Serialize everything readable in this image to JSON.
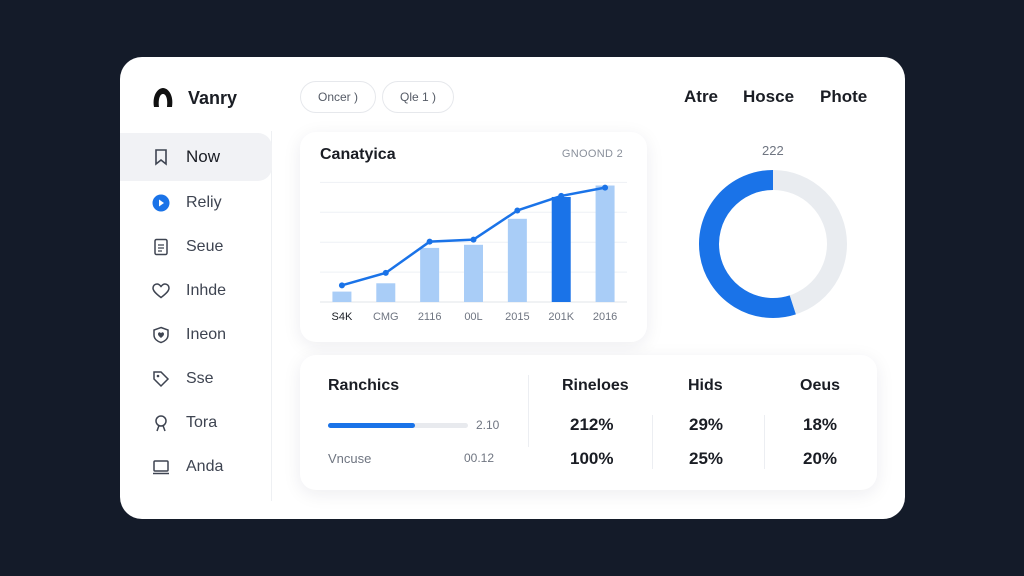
{
  "app": {
    "name": "Vanry"
  },
  "top_pills": [
    "Oncer )",
    "Qle 1 )"
  ],
  "top_nav": [
    "Atre",
    "Hosce",
    "Phote"
  ],
  "sidebar": {
    "items": [
      {
        "label": "Now",
        "icon": "bookmark-icon",
        "active": true
      },
      {
        "label": "Reliy",
        "icon": "play-circle-icon",
        "active": false
      },
      {
        "label": "Seue",
        "icon": "document-icon",
        "active": false
      },
      {
        "label": "Inhde",
        "icon": "heart-icon",
        "active": false
      },
      {
        "label": "Ineon",
        "icon": "shield-heart-icon",
        "active": false
      },
      {
        "label": "Sse",
        "icon": "tag-icon",
        "active": false
      },
      {
        "label": "Tora",
        "icon": "user-icon",
        "active": false
      },
      {
        "label": "Anda",
        "icon": "monitor-icon",
        "active": false
      }
    ]
  },
  "colors": {
    "accent": "#1a73e8",
    "bar_light": "#a9cdf7",
    "bar_dark": "#1a73e8",
    "track": "#e9ecf0"
  },
  "chart_data": {
    "type": "bar",
    "title": "Canatyica",
    "tag": "GNOOND 2",
    "categories": [
      "S4K",
      "CMG",
      "2116",
      "00L",
      "2015",
      "201K",
      "2016"
    ],
    "series": [
      {
        "values": [
          10,
          18,
          52,
          55,
          80,
          101,
          112
        ]
      },
      {
        "values": [
          16,
          28,
          58,
          60,
          88,
          102,
          110
        ]
      }
    ],
    "highlight_index": 5,
    "ylim": [
      0,
      125
    ]
  },
  "donut": {
    "label": "222",
    "fraction": 0.55
  },
  "stats": {
    "title": "Ranchics",
    "progress": 0.62,
    "progress_value": "2.10",
    "sub_label": "Vncuse",
    "sub_value": "00.12",
    "columns": [
      {
        "header": "Rineloes",
        "values": [
          "212%",
          "100%"
        ]
      },
      {
        "header": "Hids",
        "values": [
          "29%",
          "25%"
        ]
      },
      {
        "header": "Oeus",
        "values": [
          "18%",
          "20%"
        ]
      }
    ]
  }
}
